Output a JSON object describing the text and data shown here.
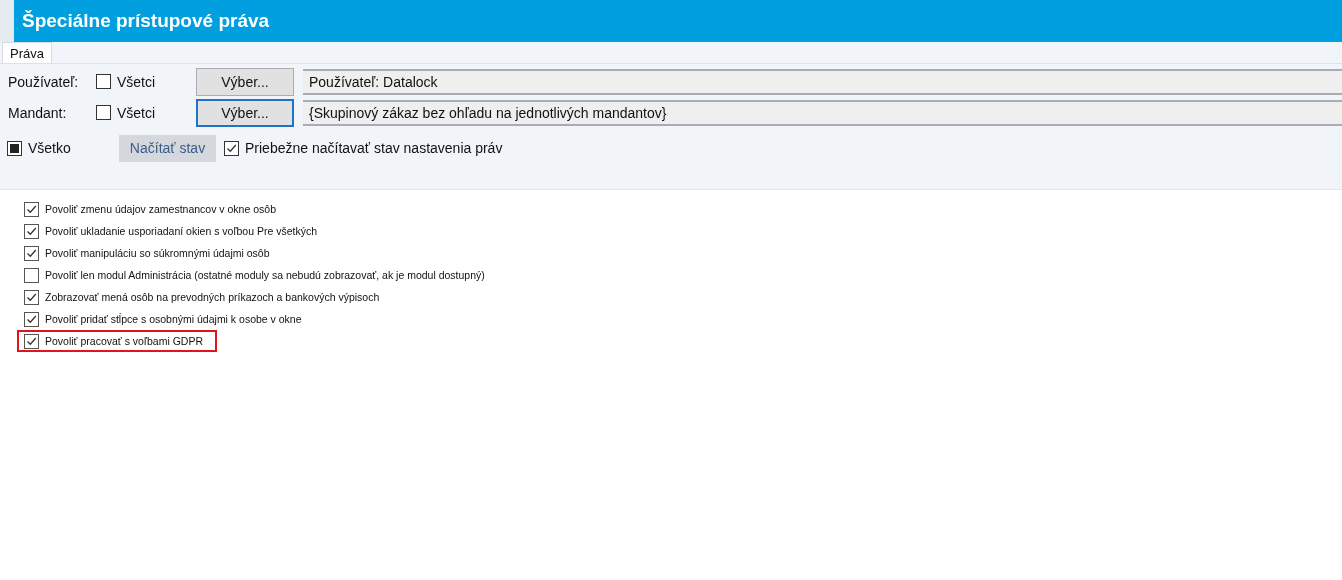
{
  "window": {
    "title": "Špeciálne prístupové práva"
  },
  "tabs": [
    {
      "label": "Práva",
      "selected": true
    }
  ],
  "filters": [
    {
      "label": "Používateľ:",
      "all_label": "Všetci",
      "all_checked": false,
      "button": "Výber...",
      "focused": false,
      "value": "Používateľ: Datalock"
    },
    {
      "label": "Mandant:",
      "all_label": "Všetci",
      "all_checked": false,
      "button": "Výber...",
      "focused": true,
      "value": "{Skupinový zákaz bez ohľadu na jednotlivých mandantov}"
    }
  ],
  "select_all": {
    "label": "Všetko",
    "indeterminate": true
  },
  "load_button": {
    "label": "Načítať stav",
    "disabled": true
  },
  "auto_load": {
    "label": "Priebežne načítavať stav nastavenia práv",
    "checked": true
  },
  "permissions": [
    {
      "label": "Povoliť zmenu údajov zamestnancov v okne osôb",
      "checked": true,
      "highlighted": false
    },
    {
      "label": "Povoliť ukladanie usporiadaní okien s voľbou Pre všetkých",
      "checked": true,
      "highlighted": false
    },
    {
      "label": "Povoliť manipuláciu so súkromnými údajmi osôb",
      "checked": true,
      "highlighted": false
    },
    {
      "label": "Povoliť len modul Administrácia (ostatné moduly sa nebudú zobrazovať, ak je modul dostupný)",
      "checked": false,
      "highlighted": false
    },
    {
      "label": "Zobrazovať mená osôb na prevodných príkazoch a bankových výpisoch",
      "checked": true,
      "highlighted": false
    },
    {
      "label": "Povoliť pridať stĺpce s osobnými údajmi k osobe v okne",
      "checked": true,
      "highlighted": false
    },
    {
      "label": "Povoliť pracovať s voľbami GDPR",
      "checked": true,
      "highlighted": true
    }
  ]
}
